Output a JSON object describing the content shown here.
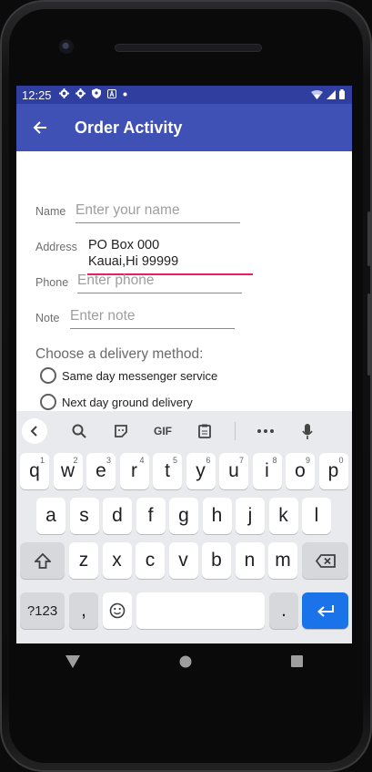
{
  "status_bar": {
    "time": "12:25",
    "icons": [
      "gear-icon",
      "gear-icon",
      "shield-icon",
      "a-icon",
      "dot-icon"
    ],
    "right_icons": [
      "wifi-icon",
      "signal-icon",
      "battery-icon"
    ]
  },
  "app_bar": {
    "title": "Order Activity",
    "back_icon": "arrow-left-icon"
  },
  "form": {
    "name_label": "Name",
    "name_placeholder": "Enter your name",
    "address_label": "Address",
    "address_line1": "PO Box 000",
    "address_line2": "Kauai,Hi 99999",
    "phone_label": "Phone",
    "phone_placeholder": "Enter phone",
    "note_label": "Note",
    "note_placeholder": "Enter note",
    "delivery_prompt": "Choose a delivery method:",
    "options": [
      {
        "label": "Same day messenger service",
        "selected": false
      },
      {
        "label": "Next day ground delivery",
        "selected": false
      }
    ]
  },
  "keyboard": {
    "toolbar": [
      "chevron-left-icon",
      "search-icon",
      "sticker-icon",
      "GIF",
      "clipboard-icon",
      "more-icon",
      "mic-icon"
    ],
    "row1": [
      {
        "k": "q",
        "h": "1"
      },
      {
        "k": "w",
        "h": "2"
      },
      {
        "k": "e",
        "h": "3"
      },
      {
        "k": "r",
        "h": "4"
      },
      {
        "k": "t",
        "h": "5"
      },
      {
        "k": "y",
        "h": "6"
      },
      {
        "k": "u",
        "h": "7"
      },
      {
        "k": "i",
        "h": "8"
      },
      {
        "k": "o",
        "h": "9"
      },
      {
        "k": "p",
        "h": "0"
      }
    ],
    "row2": [
      "a",
      "s",
      "d",
      "f",
      "g",
      "h",
      "j",
      "k",
      "l"
    ],
    "row3": [
      "z",
      "x",
      "c",
      "v",
      "b",
      "n",
      "m"
    ],
    "symbols_label": "?123",
    "comma_label": ",",
    "period_label": ".",
    "accent_color": "#1a73e8"
  },
  "colors": {
    "status_bar": "#303f9f",
    "app_bar": "#3f51b5",
    "focus_underline": "#e91e63"
  }
}
